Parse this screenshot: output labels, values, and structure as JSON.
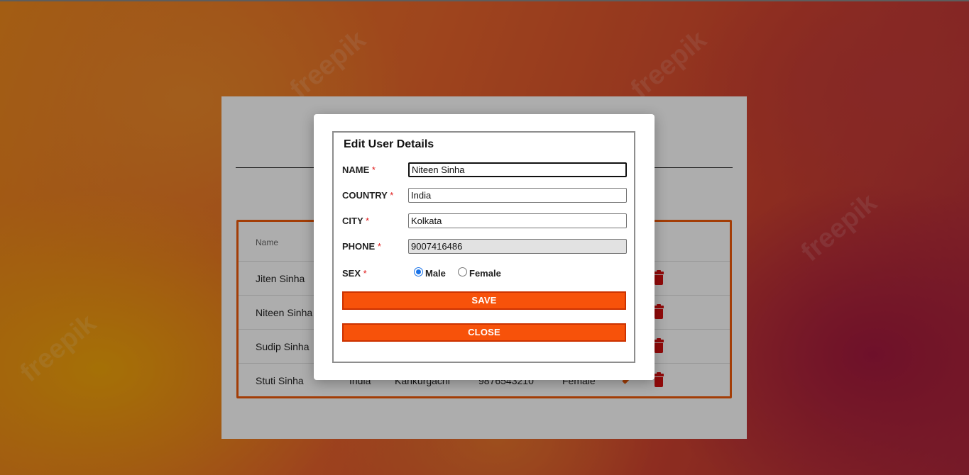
{
  "background": {
    "watermark": "freepik"
  },
  "table": {
    "header": {
      "name": "Name"
    },
    "rows": [
      {
        "name": "Jiten Sinha"
      },
      {
        "name": "Niteen Sinha"
      },
      {
        "name": "Sudip Sinha"
      },
      {
        "name": "Stuti Sinha",
        "country": "India",
        "city": "Kankurgachi",
        "phone": "9876543210",
        "sex": "Female"
      }
    ]
  },
  "modal": {
    "title": "Edit User Details",
    "fields": {
      "name": {
        "label": "NAME",
        "value": "Niteen Sinha"
      },
      "country": {
        "label": "COUNTRY",
        "value": "India"
      },
      "city": {
        "label": "CITY",
        "value": "Kolkata"
      },
      "phone": {
        "label": "PHONE",
        "value": "9007416486"
      },
      "sex": {
        "label": "SEX",
        "options": [
          "Male",
          "Female"
        ],
        "selected": "Male"
      }
    },
    "required_marker": "*",
    "save_label": "SAVE",
    "close_label": "CLOSE"
  },
  "colors": {
    "accent": "#f7520a",
    "danger": "#d60f0f",
    "radio": "#1a73e8"
  }
}
